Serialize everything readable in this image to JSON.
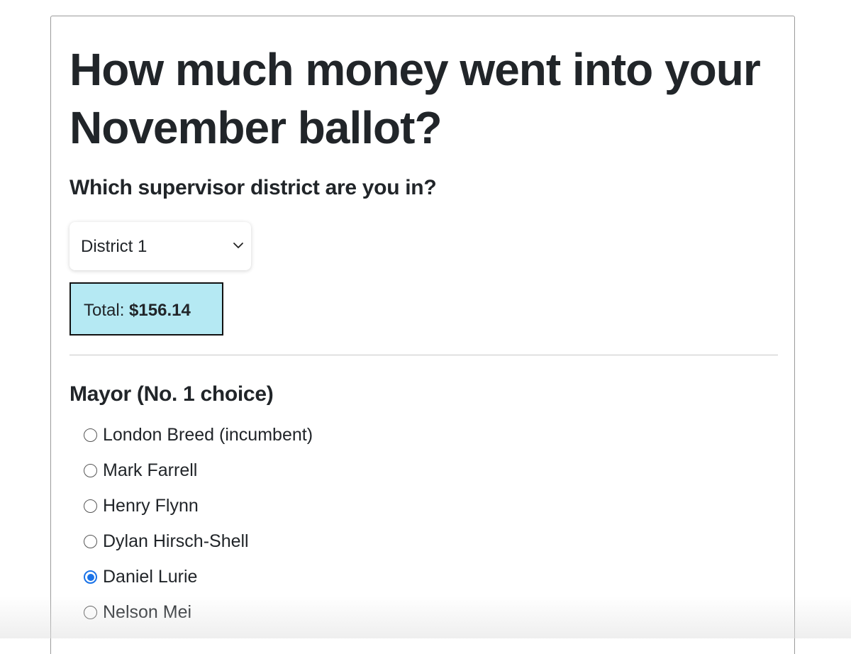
{
  "page": {
    "title": "How much money went into your November ballot?",
    "district_question": "Which supervisor district are you in?"
  },
  "district_select": {
    "selected": "District 1"
  },
  "total": {
    "label": "Total:",
    "amount": "$156.14",
    "background_color": "#b5e9f3"
  },
  "mayor_section": {
    "title": "Mayor (No. 1 choice)",
    "options": [
      {
        "label": "London Breed (incumbent)",
        "checked": false
      },
      {
        "label": "Mark Farrell",
        "checked": false
      },
      {
        "label": "Henry Flynn",
        "checked": false
      },
      {
        "label": "Dylan Hirsch-Shell",
        "checked": false
      },
      {
        "label": "Daniel Lurie",
        "checked": true
      },
      {
        "label": "Nelson Mei",
        "checked": false
      }
    ]
  },
  "icons": {
    "select_chevron": "chevron-down-icon"
  },
  "colors": {
    "radio_checked": "#1a73e8",
    "text": "#212529"
  }
}
